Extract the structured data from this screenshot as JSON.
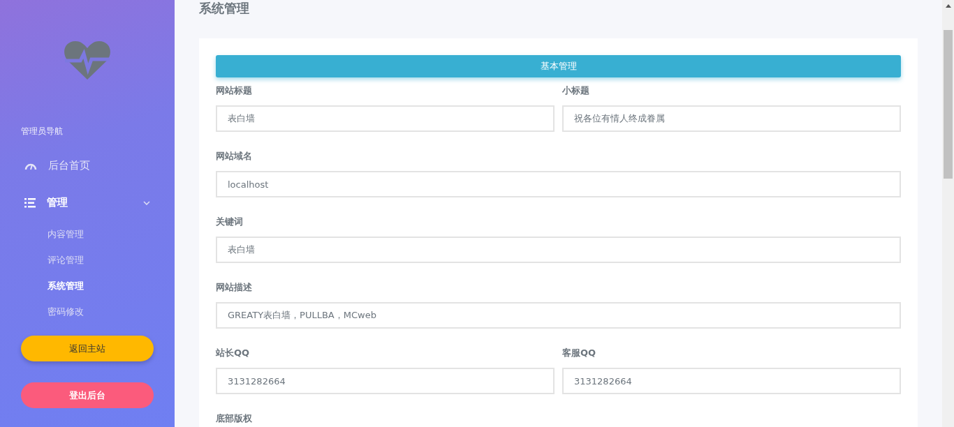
{
  "sidebar": {
    "nav_heading": "管理员导航",
    "items": [
      {
        "kind": "link",
        "label": "后台首页"
      },
      {
        "kind": "group",
        "label": "管理",
        "children": [
          {
            "label": "内容管理",
            "selected": false
          },
          {
            "label": "评论管理",
            "selected": false
          },
          {
            "label": "系统管理",
            "selected": true
          },
          {
            "label": "密码修改",
            "selected": false
          }
        ]
      }
    ],
    "buttons": [
      {
        "kind": "home",
        "label": "返回主站"
      },
      {
        "kind": "logout",
        "label": "登出后台"
      }
    ]
  },
  "page_title": "系统管理",
  "section_header": "基本管理",
  "form_rows": [
    [
      {
        "label": "网站标题",
        "value": "表白墙"
      },
      {
        "label": "小标题",
        "value": "祝各位有情人终成眷属"
      }
    ],
    [
      {
        "label": "网站域名",
        "value": "localhost"
      }
    ],
    [
      {
        "label": "关键词",
        "value": "表白墙"
      }
    ],
    [
      {
        "label": "网站描述",
        "value": "GREATY表白墙，PULLBA，MCweb"
      }
    ],
    [
      {
        "label": "站长QQ",
        "value": "3131282664"
      },
      {
        "label": "客服QQ",
        "value": "3131282664"
      }
    ],
    [
      {
        "label": "底部版权"
      }
    ]
  ]
}
